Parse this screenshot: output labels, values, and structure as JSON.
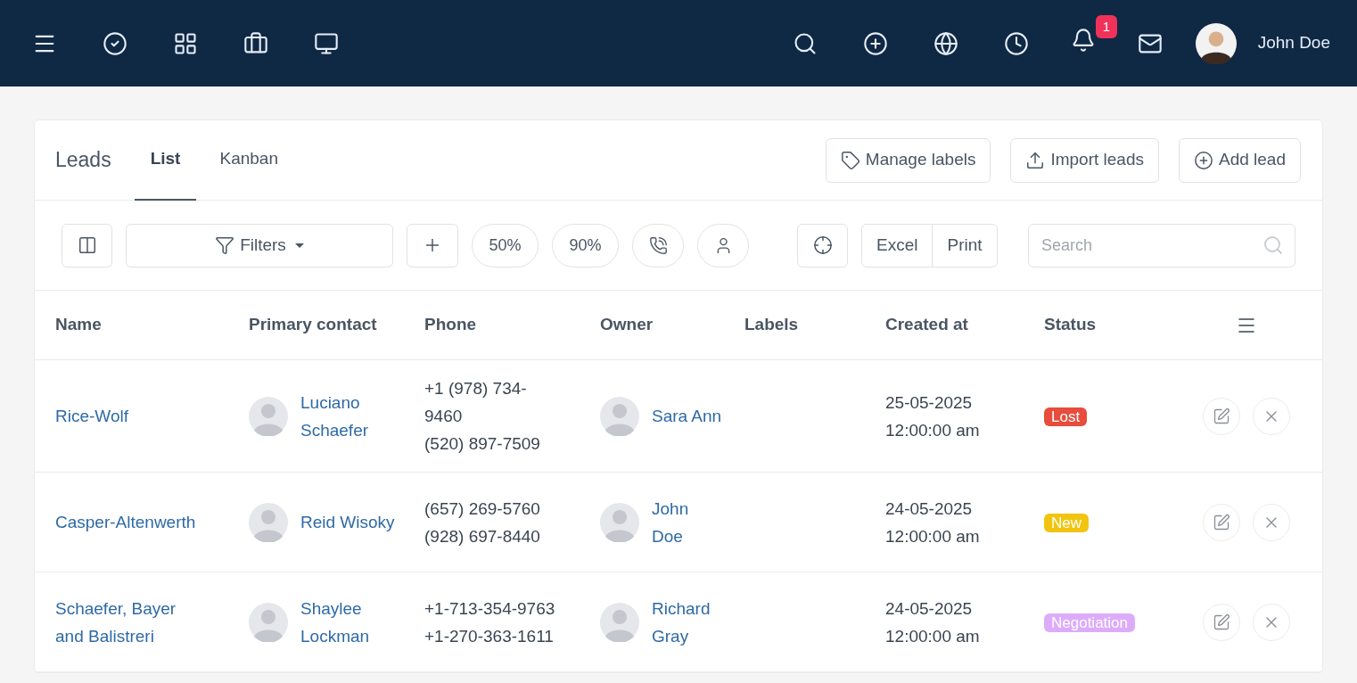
{
  "topbar": {
    "user_name": "John Doe",
    "notification_count": "1"
  },
  "leads": {
    "title": "Leads",
    "tabs": [
      {
        "label": "List",
        "selected": true
      },
      {
        "label": "Kanban",
        "selected": false
      }
    ],
    "actions": [
      "Manage labels",
      "Import leads",
      "Add lead"
    ]
  },
  "toolbar": {
    "filters": "Filters",
    "quick_filters": [
      "50%",
      "90%"
    ],
    "export": [
      "Excel",
      "Print"
    ],
    "search": {
      "placeholder": "Search"
    }
  },
  "table": {
    "columns": [
      "Name",
      "Primary contact",
      "Phone",
      "Owner",
      "Labels",
      "Created at",
      "Status"
    ],
    "rows": [
      {
        "name": "Rice-Wolf",
        "contact": "Luciano Schaefer",
        "phones": [
          "+1 (978) 734-9460",
          "(520) 897-7509"
        ],
        "owner": "Sara Ann",
        "created": [
          "25-05-2025",
          "12:00:00 am"
        ],
        "status": {
          "label": "Lost",
          "color": "#e74c3c"
        }
      },
      {
        "name": "Casper-Altenwerth",
        "contact": "Reid Wisoky",
        "phones": [
          "(657) 269-5760",
          "(928) 697-8440"
        ],
        "owner": "John Doe",
        "created": [
          "24-05-2025",
          "12:00:00 am"
        ],
        "status": {
          "label": "New",
          "color": "#f1c40f"
        }
      },
      {
        "name": "Schaefer, Bayer and Balistreri",
        "contact": "Shaylee Lockman",
        "phones": [
          "+1-713-354-9763",
          "+1-270-363-1611"
        ],
        "owner": "Richard Gray",
        "created": [
          "24-05-2025",
          "12:00:00 am"
        ],
        "status": {
          "label": "Negotiation",
          "color": "#dcacfb"
        }
      }
    ]
  }
}
